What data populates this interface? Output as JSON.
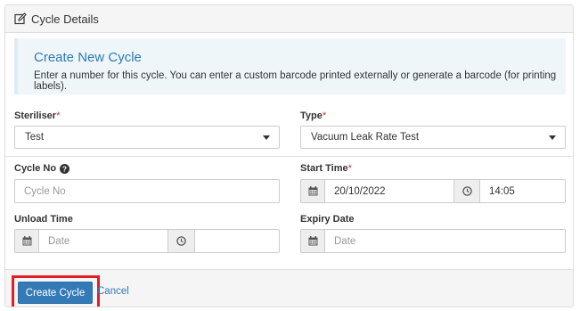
{
  "panel": {
    "title": "Cycle Details",
    "title_icon": "edit-icon"
  },
  "alert": {
    "title": "Create New Cycle",
    "text": "Enter a number for this cycle. You can enter a custom barcode printed externally or generate a barcode (for printing labels)."
  },
  "form": {
    "steriliser": {
      "label": "Steriliser",
      "required_mark": "*",
      "value": "Test"
    },
    "type": {
      "label": "Type",
      "required_mark": "*",
      "value": "Vacuum Leak Rate Test"
    },
    "cycle_no": {
      "label": "Cycle No",
      "placeholder": "Cycle No",
      "help_icon": "question-circle-icon"
    },
    "start_time": {
      "label": "Start Time",
      "required_mark": "*",
      "date": "20/10/2022",
      "time": "14:05"
    },
    "unload_time": {
      "label": "Unload Time",
      "date_placeholder": "Date",
      "time": ""
    },
    "expiry_date": {
      "label": "Expiry Date",
      "date_placeholder": "Date"
    }
  },
  "footer": {
    "create_label": "Create Cycle",
    "cancel_label": "Cancel"
  },
  "colors": {
    "primary": "#337ab7",
    "highlight": "#e41e26",
    "alert_bg": "#eef6fa",
    "alert_title": "#2e7ab8"
  }
}
